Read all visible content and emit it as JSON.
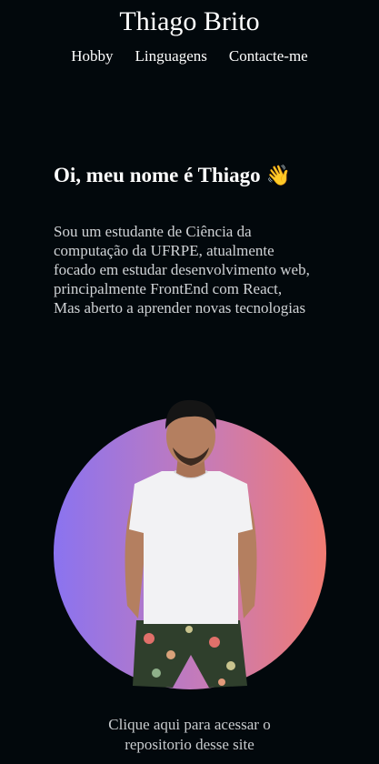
{
  "header": {
    "title": "Thiago Brito",
    "nav": [
      "Hobby",
      "Linguagens",
      "Contacte-me"
    ]
  },
  "about": {
    "greeting": "Oi, meu nome é Thiago",
    "greeting_icon": "waving-hand-icon",
    "greeting_emoji": "👋",
    "intro_lines": [
      "Sou um estudante de Ciência da",
      "computação da UFRPE, atualmente",
      "focado em estudar desenvolvimento web,",
      "principalmente FrontEnd com React,",
      "Mas aberto a aprender novas tecnologias"
    ]
  },
  "footer": {
    "repo_link_lines": [
      "Clique aqui para acessar o",
      "repositorio desse site"
    ]
  },
  "colors": {
    "background": "#02080c",
    "gradient_start": "#8a73f0",
    "gradient_end": "#f17b72"
  }
}
